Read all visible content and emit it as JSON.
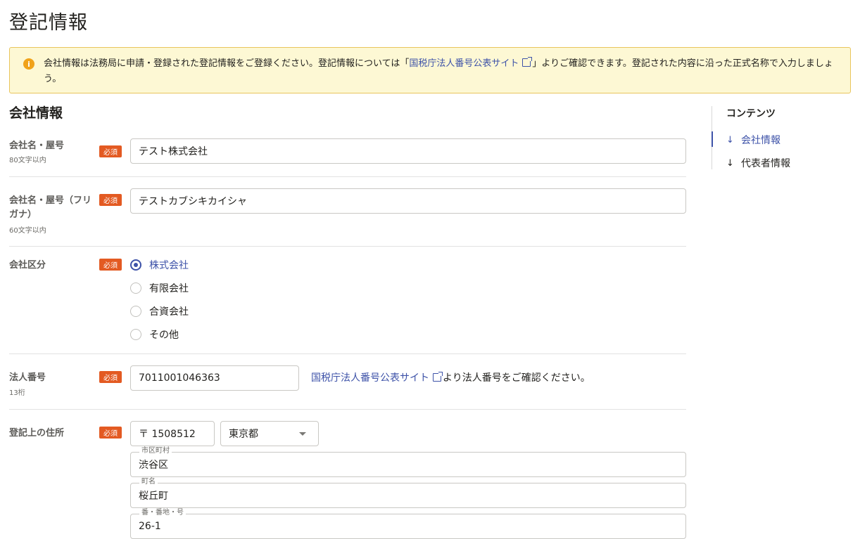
{
  "page": {
    "title": "登記情報"
  },
  "notice": {
    "icon": "info-icon",
    "icon_glyph": "i",
    "text_before": "会社情報は法務局に申請・登録された登記情報をご登録ください。登記情報については「",
    "link_text": "国税庁法人番号公表サイト",
    "text_after": "」よりご確認できます。登記された内容に沿った正式名称で入力しましょう。"
  },
  "section": {
    "heading": "会社情報"
  },
  "required_label": "必須",
  "fields": {
    "company_name": {
      "label": "会社名・屋号",
      "hint": "80文字以内",
      "value": "テスト株式会社"
    },
    "company_kana": {
      "label": "会社名・屋号（フリガナ）",
      "hint": "60文字以内",
      "value": "テストカブシキカイシャ"
    },
    "company_type": {
      "label": "会社区分",
      "selected": "株式会社",
      "options": [
        "株式会社",
        "有限会社",
        "合資会社",
        "その他"
      ]
    },
    "corporate_number": {
      "label": "法人番号",
      "hint": "13桁",
      "value": "7011001046363",
      "help_link": "国税庁法人番号公表サイト",
      "help_text": "より法人番号をご確認ください。"
    },
    "address": {
      "label": "登記上の住所",
      "postal": "〒 1508512",
      "prefecture": "東京都",
      "city_label": "市区町村",
      "city": "渋谷区",
      "town_label": "町名",
      "town": "桜丘町",
      "block_label": "番・番地・号",
      "block": "26-1"
    }
  },
  "toc": {
    "title": "コンテンツ",
    "items": [
      {
        "label": "会社情報",
        "icon": "arrow-down-icon",
        "active": true
      },
      {
        "label": "代表者情報",
        "icon": "arrow-down-icon",
        "active": false
      }
    ]
  },
  "colors": {
    "accent": "#3d52a8",
    "required": "#e35a22",
    "notice_bg": "#fdf8d4",
    "notice_border": "#e8c45c"
  }
}
